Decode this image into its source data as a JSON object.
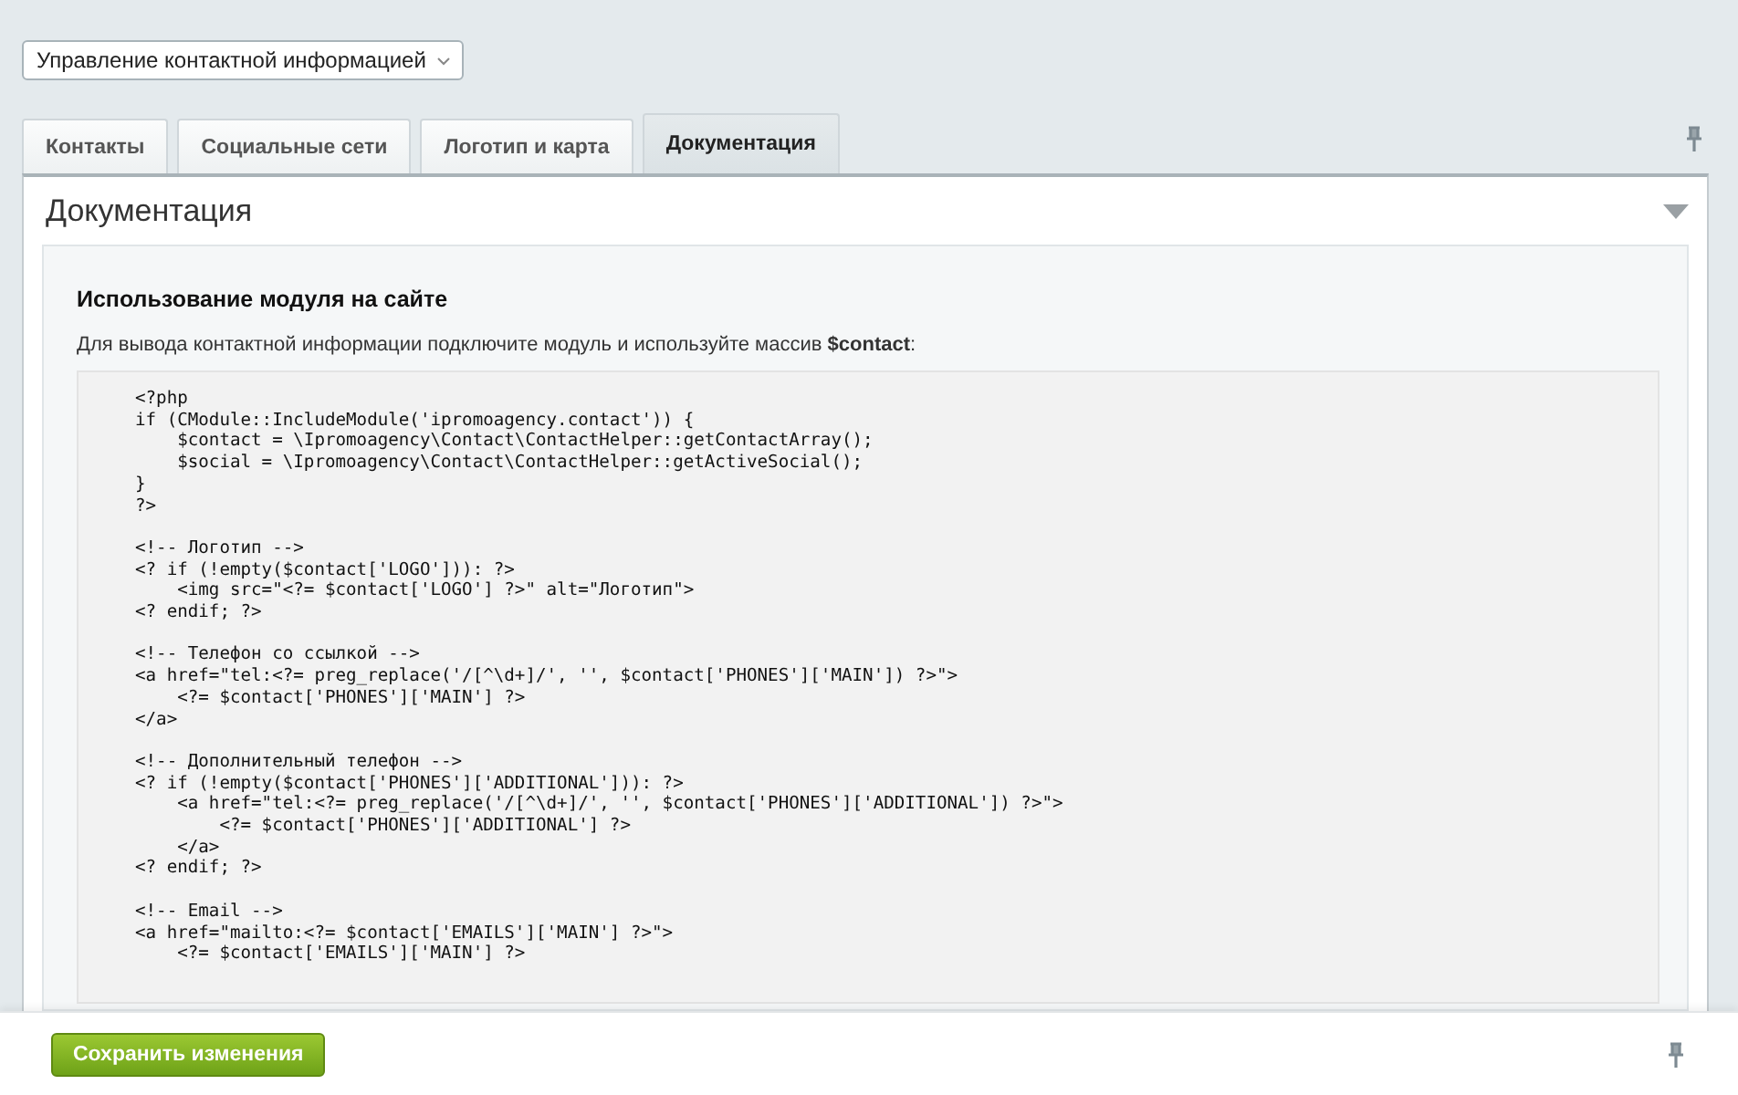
{
  "context_select": {
    "value": "Управление контактной информацией"
  },
  "tabs": [
    {
      "label": "Контакты",
      "selected": false
    },
    {
      "label": "Социальные сети",
      "selected": false
    },
    {
      "label": "Логотип и карта",
      "selected": false
    },
    {
      "label": "Документация",
      "selected": true
    }
  ],
  "panel": {
    "title": "Документация",
    "expanded": true,
    "section_heading": "Использование модуля на сайте",
    "intro": "Для вывода контактной информации подключите модуль и используйте массив **$contact**:",
    "code": "<?php\nif (CModule::IncludeModule('ipromoagency.contact')) {\n    $contact = \\Ipromoagency\\Contact\\ContactHelper::getContactArray();\n    $social = \\Ipromoagency\\Contact\\ContactHelper::getActiveSocial();\n}\n?>\n\n<!-- Логотип -->\n<? if (!empty($contact['LOGO'])): ?>\n    <img src=\"<?= $contact['LOGO'] ?>\" alt=\"Логотип\">\n<? endif; ?>\n\n<!-- Телефон со ссылкой -->\n<a href=\"tel:<?= preg_replace('/[^\\d+]/', '', $contact['PHONES']['MAIN']) ?>\">\n    <?= $contact['PHONES']['MAIN'] ?>\n</a>\n\n<!-- Дополнительный телефон -->\n<? if (!empty($contact['PHONES']['ADDITIONAL'])): ?>\n    <a href=\"tel:<?= preg_replace('/[^\\d+]/', '', $contact['PHONES']['ADDITIONAL']) ?>\">\n        <?= $contact['PHONES']['ADDITIONAL'] ?>\n    </a>\n<? endif; ?>\n\n<!-- Email -->\n<a href=\"mailto:<?= $contact['EMAILS']['MAIN'] ?>\">\n    <?= $contact['EMAILS']['MAIN'] ?>"
  },
  "footer": {
    "save_button": "Сохранить изменения"
  }
}
